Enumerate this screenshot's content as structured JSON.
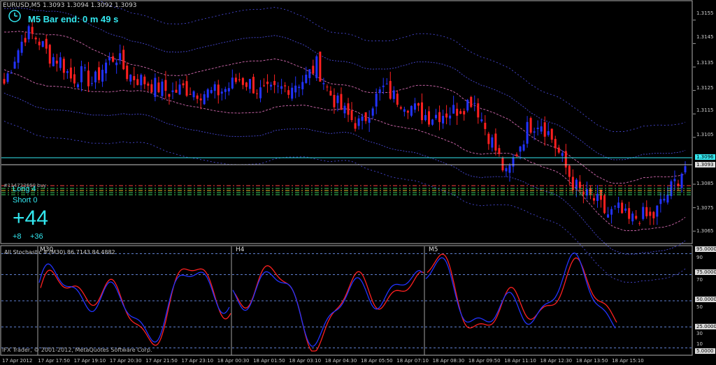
{
  "title": "EURUSD,M5  1.3093 1.3094 1.3092 1.3093",
  "bar_end": "M5 Bar end: 0 m 49 s",
  "signal": {
    "long": "Long  4",
    "short": "Short  0",
    "total": "+44",
    "a": "+8",
    "b": "+36"
  },
  "order_label": "#114723660 buy",
  "stoch_label": "All Stochastic 4 (M30) 86.7143 84.4882",
  "timeframes": [
    "M30",
    "H4",
    "M5"
  ],
  "copyright": "IFX Trader, © 2001-2012, MetaQuotes Software Corp.",
  "price_axis": [
    "1.3155",
    "1.3145",
    "1.3135",
    "1.3125",
    "1.3115",
    "1.3105",
    "1.3085",
    "1.3075",
    "1.3065"
  ],
  "price_tags": {
    "upper": "1.3096",
    "current": "1.3093"
  },
  "stoch_axis": [
    "90",
    "70",
    "50",
    "30",
    "10"
  ],
  "stoch_tags": [
    "95.0000",
    "75.0000",
    "50.0000",
    "25.0000",
    "5.0000"
  ],
  "time_axis": [
    "17 Apr 2012",
    "17 Apr 17:50",
    "17 Apr 19:10",
    "17 Apr 20:30",
    "17 Apr 21:50",
    "17 Apr 23:10",
    "18 Apr 00:30",
    "18 Apr 01:50",
    "18 Apr 03:10",
    "18 Apr 04:30",
    "18 Apr 05:50",
    "18 Apr 07:10",
    "18 Apr 08:30",
    "18 Apr 09:50",
    "18 Apr 11:10",
    "18 Apr 12:30",
    "18 Apr 13:50",
    "18 Apr 15:10"
  ],
  "colors": {
    "bull": "#2233ff",
    "bear": "#ff2020",
    "band": "#4040c0",
    "mid": "#c060a0",
    "accent": "#33e8f0"
  },
  "chart_data": {
    "type": "line",
    "symbol": "EURUSD,M5",
    "price_range": [
      1.306,
      1.316
    ],
    "series_path": [
      1.3128,
      1.314,
      1.315,
      1.3147,
      1.314,
      1.3138,
      1.313,
      1.3132,
      1.3128,
      1.3136,
      1.314,
      1.3132,
      1.313,
      1.3128,
      1.3126,
      1.3124,
      1.3126,
      1.3125,
      1.3124,
      1.3124,
      1.3126,
      1.313,
      1.3128,
      1.3124,
      1.3124,
      1.3126,
      1.3128,
      1.313,
      1.3136,
      1.3125,
      1.3118,
      1.3113,
      1.311,
      1.312,
      1.3126,
      1.3122,
      1.312,
      1.3116,
      1.3114,
      1.3115,
      1.3116,
      1.3118,
      1.3122,
      1.311,
      1.31,
      1.3088,
      1.31,
      1.311,
      1.3112,
      1.3105,
      1.3095,
      1.3085,
      1.308,
      1.3078,
      1.3072,
      1.3074,
      1.3069,
      1.3072,
      1.307,
      1.3078,
      1.3085,
      1.3093
    ],
    "stochastic_levels": [
      95,
      75,
      50,
      25,
      5
    ]
  }
}
